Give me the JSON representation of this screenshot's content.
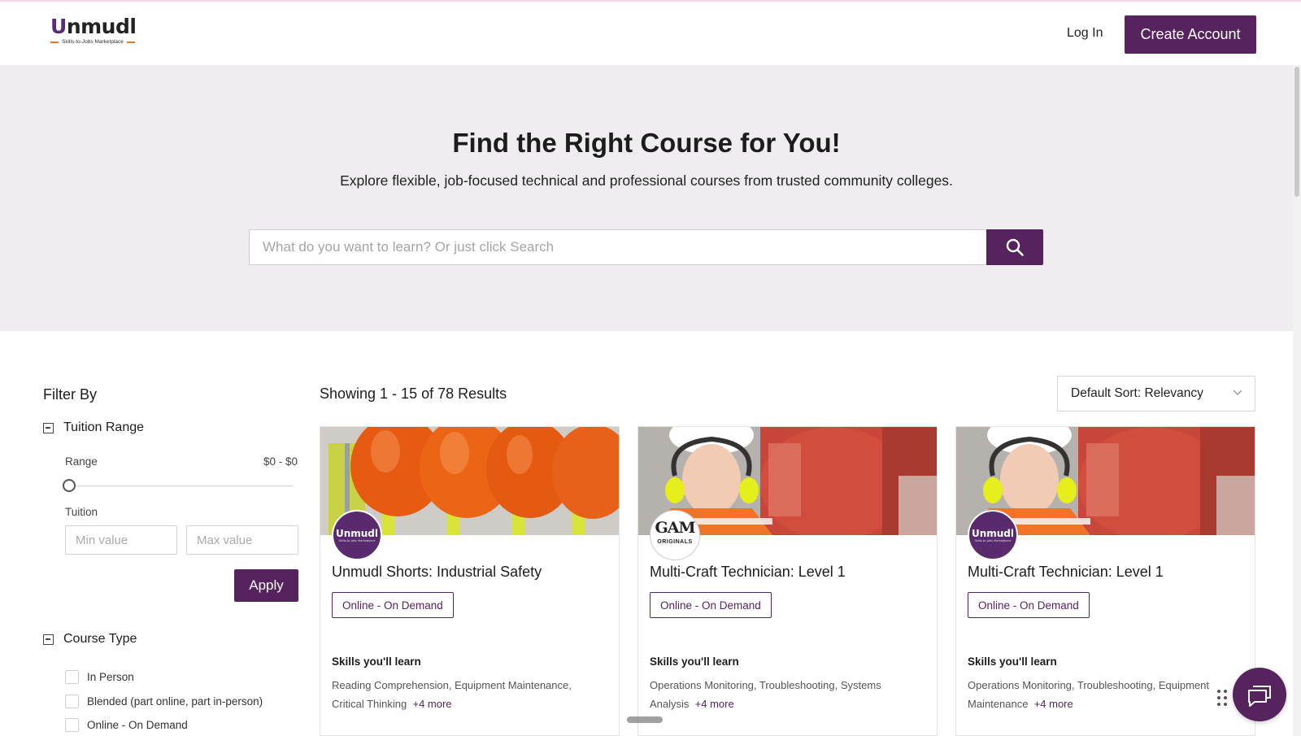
{
  "header": {
    "logo_text": "Unmudl",
    "logo_tagline": "Skills-to-Jobs Marketplace",
    "login_label": "Log In",
    "create_account_label": "Create Account"
  },
  "hero": {
    "title": "Find the Right Course for You!",
    "subtitle": "Explore flexible, job-focused technical and professional courses from trusted community colleges.",
    "search_placeholder": "What do you want to learn? Or just click Search"
  },
  "filters": {
    "title": "Filter By",
    "tuition": {
      "heading": "Tuition Range",
      "range_label": "Range",
      "range_value": "$0 - $0",
      "tuition_label": "Tuition",
      "min_placeholder": "Min value",
      "max_placeholder": "Max value",
      "apply_label": "Apply"
    },
    "course_type": {
      "heading": "Course Type",
      "options": [
        "In Person",
        "Blended (part online, part in-person)",
        "Online - On Demand"
      ]
    }
  },
  "results": {
    "count_text": "Showing 1 - 15 of 78 Results",
    "sort_label": "Default Sort: Relevancy",
    "skills_heading": "Skills you'll learn",
    "cards": [
      {
        "provider": "Unmudl",
        "title": "Unmudl Shorts: Industrial Safety",
        "tag": "Online - On Demand",
        "skills": "Reading Comprehension, Equipment Maintenance, Critical Thinking",
        "more": "+4 more"
      },
      {
        "provider": "GAM",
        "provider_sub": "ORIGINALS",
        "title": "Multi-Craft Technician: Level 1",
        "tag": "Online - On Demand",
        "skills": "Operations Monitoring, Troubleshooting, Systems Analysis",
        "more": "+4 more"
      },
      {
        "provider": "Unmudl",
        "title": "Multi-Craft Technician: Level 1",
        "tag": "Online - On Demand",
        "skills": "Operations Monitoring, Troubleshooting, Equipment Maintenance",
        "more": "+4 more"
      }
    ]
  },
  "colors": {
    "brand_purple": "#56235f",
    "hero_bg": "#efedef",
    "accent_orange": "#e8792a"
  }
}
